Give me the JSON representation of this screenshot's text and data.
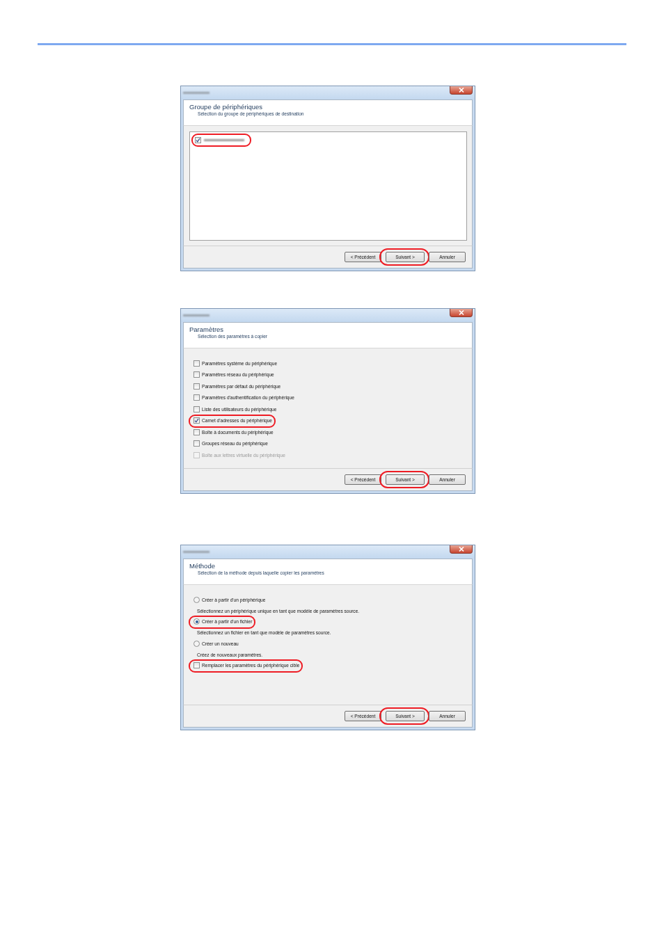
{
  "dialogs": [
    {
      "title": "Groupe de périphériques",
      "subtitle": "Sélection du groupe de périphériques de destination",
      "body": {
        "kind": "listbox",
        "items": [
          {
            "kind": "blurred-checkbox",
            "checked": true,
            "highlighted": true
          }
        ]
      },
      "buttons": [
        {
          "label": "< Précédent",
          "highlighted": false
        },
        {
          "label": "Suivant >",
          "highlighted": true
        },
        {
          "label": "Annuler",
          "highlighted": false
        }
      ]
    },
    {
      "title": "Paramètres",
      "subtitle": "Sélection des paramètres à copier",
      "body": {
        "kind": "options",
        "items": [
          {
            "kind": "checkbox",
            "label": "Paramètres système du périphérique",
            "checked": false,
            "disabled": false,
            "highlighted": false
          },
          {
            "kind": "checkbox",
            "label": "Paramètres réseau du périphérique",
            "checked": false,
            "disabled": false,
            "highlighted": false
          },
          {
            "kind": "checkbox",
            "label": "Paramètres par défaut du périphérique",
            "checked": false,
            "disabled": false,
            "highlighted": false
          },
          {
            "kind": "checkbox",
            "label": "Paramètres d'authentification du périphérique",
            "checked": false,
            "disabled": false,
            "highlighted": false
          },
          {
            "kind": "checkbox",
            "label": "Liste des utilisateurs du périphérique",
            "checked": false,
            "disabled": false,
            "highlighted": false
          },
          {
            "kind": "checkbox",
            "label": "Carnet d'adresses du périphérique",
            "checked": true,
            "disabled": false,
            "highlighted": true
          },
          {
            "kind": "checkbox",
            "label": "Boîte à documents du périphérique",
            "checked": false,
            "disabled": false,
            "highlighted": false
          },
          {
            "kind": "checkbox",
            "label": "Groupes réseau du périphérique",
            "checked": false,
            "disabled": false,
            "highlighted": false
          },
          {
            "kind": "checkbox",
            "label": "Boîte aux lettres virtuelle du périphérique",
            "checked": false,
            "disabled": true,
            "highlighted": false
          }
        ]
      },
      "buttons": [
        {
          "label": "< Précédent",
          "highlighted": false
        },
        {
          "label": "Suivant >",
          "highlighted": true
        },
        {
          "label": "Annuler",
          "highlighted": false
        }
      ]
    },
    {
      "title": "Méthode",
      "subtitle": "Sélection de la méthode depuis laquelle copier les paramètres",
      "body": {
        "kind": "options",
        "items": [
          {
            "kind": "radio",
            "label": "Créer à partir d'un périphérique",
            "checked": false,
            "disabled": false,
            "highlighted": false
          },
          {
            "kind": "hint",
            "label": "Sélectionnez un périphérique unique en tant que modèle de paramètres source."
          },
          {
            "kind": "radio",
            "label": "Créer à partir d'un fichier",
            "checked": true,
            "disabled": false,
            "highlighted": true
          },
          {
            "kind": "hint",
            "label": "Sélectionnez un fichier en tant que modèle de paramètres source."
          },
          {
            "kind": "radio",
            "label": "Créer un nouveau",
            "checked": false,
            "disabled": false,
            "highlighted": false
          },
          {
            "kind": "hint",
            "label": "Créez de nouveaux paramètres."
          },
          {
            "kind": "checkbox",
            "label": "Remplacer les paramètres du périphérique cible",
            "checked": false,
            "disabled": false,
            "highlighted": true
          }
        ]
      },
      "buttons": [
        {
          "label": "< Précédent",
          "highlighted": false
        },
        {
          "label": "Suivant >",
          "highlighted": true
        },
        {
          "label": "Annuler",
          "highlighted": false
        }
      ]
    }
  ]
}
